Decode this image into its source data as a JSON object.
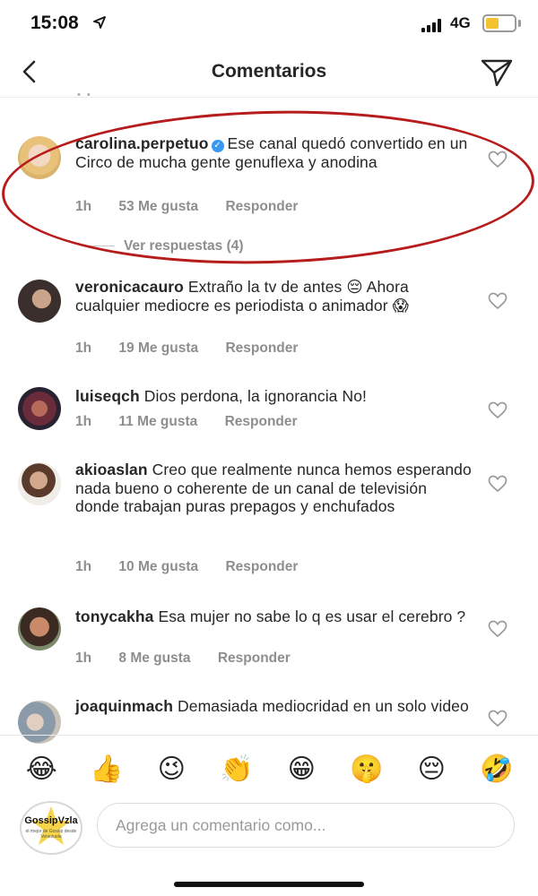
{
  "status_bar": {
    "time": "15:08",
    "network": "4G"
  },
  "header": {
    "title": "Comentarios",
    "back_icon": "chevron-left-icon",
    "send_icon": "paper-plane-icon"
  },
  "comments": [
    {
      "username": "carolina.perpetuo",
      "verified": true,
      "text": "Ese canal quedó convertido en un Circo de mucha gente genuflexa y anodina",
      "time": "1h",
      "likes": "53 Me gusta",
      "reply": "Responder",
      "view_replies": "Ver respuestas (4)",
      "highlighted": true
    },
    {
      "username": "veronicacauro",
      "text": "Extraño la tv de antes 😔 Ahora cualquier mediocre es periodista o animador 😱",
      "time": "1h",
      "likes": "19 Me gusta",
      "reply": "Responder"
    },
    {
      "username": "luiseqch",
      "text": "Dios perdona, la ignorancia No!",
      "time": "1h",
      "likes": "11 Me gusta",
      "reply": "Responder"
    },
    {
      "username": "akioaslan",
      "text": "Creo que realmente nunca hemos esperando nada bueno o coherente de un canal de televisión donde trabajan puras prepagos y enchufados",
      "time": "1h",
      "likes": "10 Me gusta",
      "reply": "Responder"
    },
    {
      "username": "tonycakha",
      "text": "Esa mujer no sabe lo q es usar el cerebro ?",
      "time": "1h",
      "likes": "8 Me gusta",
      "reply": "Responder"
    },
    {
      "username": "joaquinmach",
      "text": "Demasiada mediocridad en un solo video"
    }
  ],
  "emoji_bar": [
    "😂",
    "👍",
    "😉",
    "👏",
    "😁",
    "🤫",
    "😔",
    "🤣"
  ],
  "composer": {
    "placeholder": "Agrega un comentario como...",
    "avatar_brand": "GossipVzla",
    "avatar_tagline": "el mejor de Gossip desde Venezuela"
  },
  "colors": {
    "verified": "#3897f0",
    "highlight_ring": "#b71c1c",
    "muted_text": "#8e8e8e",
    "battery": "#f4c430"
  }
}
